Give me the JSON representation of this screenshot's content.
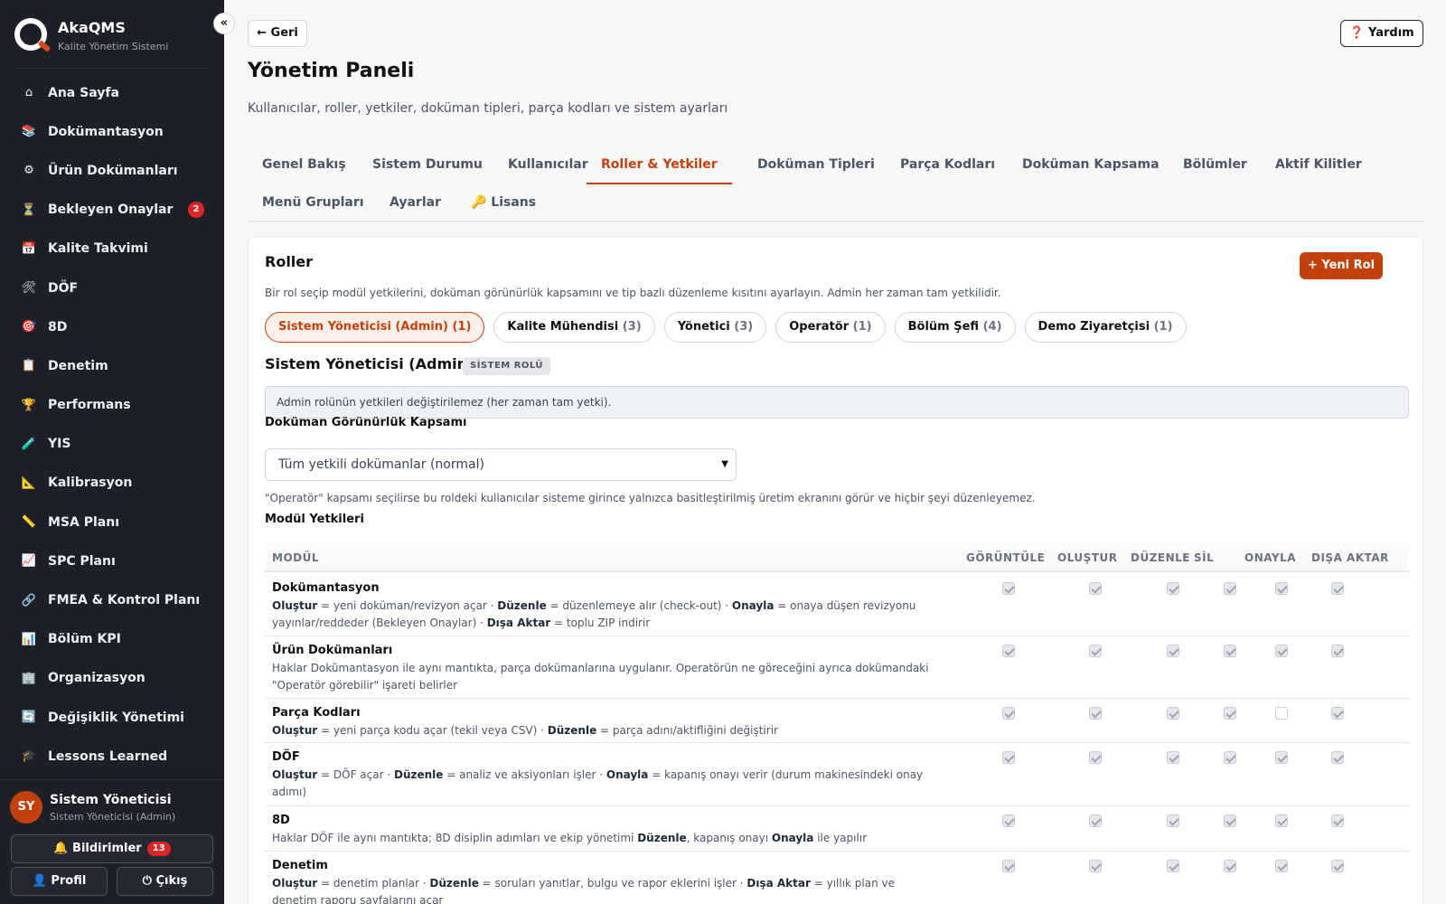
{
  "app": {
    "name": "AkaQMS",
    "subtitle": "Kalite Yönetim Sistemi",
    "collapse_icon": "«"
  },
  "sidebar": {
    "items": [
      {
        "label": "Ana Sayfa",
        "icon": "home-icon",
        "glyph": "⌂"
      },
      {
        "label": "Dokümantasyon",
        "icon": "books-icon",
        "glyph": "📚"
      },
      {
        "label": "Ürün Dokümanları",
        "icon": "gear-icon",
        "glyph": "⚙"
      },
      {
        "label": "Bekleyen Onaylar",
        "icon": "hourglass-icon",
        "glyph": "⏳",
        "badge": "2"
      },
      {
        "label": "Kalite Takvimi",
        "icon": "calendar-icon",
        "glyph": "📅"
      },
      {
        "label": "DÖF",
        "icon": "tools-icon",
        "glyph": "🛠"
      },
      {
        "label": "8D",
        "icon": "target-icon",
        "glyph": "🎯"
      },
      {
        "label": "Denetim",
        "icon": "clipboard-icon",
        "glyph": "📋"
      },
      {
        "label": "Performans",
        "icon": "trophy-icon",
        "glyph": "🏆"
      },
      {
        "label": "YIS",
        "icon": "test-tube-icon",
        "glyph": "🧪"
      },
      {
        "label": "Kalibrasyon",
        "icon": "triangle-ruler-icon",
        "glyph": "📐"
      },
      {
        "label": "MSA Planı",
        "icon": "ruler-icon",
        "glyph": "📏"
      },
      {
        "label": "SPC Planı",
        "icon": "chart-up-icon",
        "glyph": "📈"
      },
      {
        "label": "FMEA & Kontrol Planı",
        "icon": "link-icon",
        "glyph": "🔗"
      },
      {
        "label": "Bölüm KPI",
        "icon": "bar-chart-icon",
        "glyph": "📊"
      },
      {
        "label": "Organizasyon",
        "icon": "building-icon",
        "glyph": "🏢"
      },
      {
        "label": "Değişiklik Yönetimi",
        "icon": "refresh-icon",
        "glyph": "🔄"
      },
      {
        "label": "Lessons Learned",
        "icon": "graduation-cap-icon",
        "glyph": "🎓"
      }
    ]
  },
  "user": {
    "initials": "SY",
    "name": "Sistem Yöneticisi",
    "role": "Sistem Yöneticisi (Admin)",
    "notifications_label": "🔔 Bildirimler",
    "notifications_count": "13",
    "profile_label": "👤 Profil",
    "logout_label": "⏻ Çıkış"
  },
  "header": {
    "back_label": "← Geri",
    "help_label": "❓ Yardım",
    "title": "Yönetim Paneli",
    "subtitle": "Kullanıcılar, roller, yetkiler, doküman tipleri, parça kodları ve sistem ayarları"
  },
  "tabs": [
    {
      "label": "Genel Bakış"
    },
    {
      "label": "Sistem Durumu"
    },
    {
      "label": "Kullanıcılar"
    },
    {
      "label": "Roller & Yetkiler",
      "active": true
    },
    {
      "label": "Doküman Tipleri"
    },
    {
      "label": "Parça Kodları"
    },
    {
      "label": "Doküman Kapsama"
    },
    {
      "label": "Bölümler"
    },
    {
      "label": "Aktif Kilitler"
    },
    {
      "label": "Menü Grupları"
    },
    {
      "label": "Ayarlar"
    },
    {
      "label": "🔑 Lisans"
    }
  ],
  "roles": {
    "title": "Roller",
    "new_role_label": "+ Yeni Rol",
    "description": "Bir rol seçip modül yetkilerini, doküman görünürlük kapsamını ve tip bazlı düzenleme kısıtını ayarlayın. Admin her zaman tam yetkilidir.",
    "list": [
      {
        "name": "Sistem Yöneticisi (Admin)",
        "count": "(1)",
        "active": true
      },
      {
        "name": "Kalite Mühendisi",
        "count": "(3)"
      },
      {
        "name": "Yönetici",
        "count": "(3)"
      },
      {
        "name": "Operatör",
        "count": "(1)"
      },
      {
        "name": "Bölüm Şefi",
        "count": "(4)"
      },
      {
        "name": "Demo Ziyaretçisi",
        "count": "(1)"
      }
    ],
    "selected_title": "Sistem Yöneticisi (Admin)",
    "system_badge": "SİSTEM ROLÜ",
    "info": "Admin rolünün yetkileri değiştirilemez (her zaman tam yetki).",
    "scope_label": "Doküman Görünürlük Kapsamı",
    "scope_value": "Tüm yetkili dokümanlar (normal)",
    "scope_note": "\"Operatör\" kapsamı seçilirse bu roldeki kullanıcılar sisteme girince yalnızca basitleştirilmiş üretim ekranını görür ve hiçbir şeyi düzenleyemez.",
    "module_perms_label": "Modül Yetkileri"
  },
  "perm_table": {
    "columns": [
      "MODÜL",
      "GÖRÜNTÜLE",
      "OLUŞTUR",
      "DÜZENLE",
      "SİL",
      "ONAYLA",
      "DIŞA AKTAR"
    ],
    "rows": [
      {
        "name": "Dokümantasyon",
        "desc_html": "<b>Oluştur</b> = yeni doküman/revizyon açar · <b>Düzenle</b> = düzenlemeye alır (check-out) · <b>Onayla</b> = onaya düşen revizyonu yayınlar/reddeder (Bekleyen Onaylar) · <b>Dışa Aktar</b> = toplu ZIP indirir",
        "perms": [
          true,
          true,
          true,
          true,
          true,
          true
        ]
      },
      {
        "name": "Ürün Dokümanları",
        "desc_html": "Haklar Dokümantasyon ile aynı mantıkta, parça dokümanlarına uygulanır. Operatörün ne göreceğini ayrıca dokümandaki \"Operatör görebilir\" işareti belirler",
        "perms": [
          true,
          true,
          true,
          true,
          true,
          true
        ]
      },
      {
        "name": "Parça Kodları",
        "desc_html": "<b>Oluştur</b> = yeni parça kodu açar (tekil veya CSV) · <b>Düzenle</b> = parça adını/aktifliğini değiştirir",
        "perms": [
          true,
          true,
          true,
          true,
          false,
          true
        ]
      },
      {
        "name": "DÖF",
        "desc_html": "<b>Oluştur</b> = DÖF açar · <b>Düzenle</b> = analiz ve aksiyonları işler · <b>Onayla</b> = kapanış onayı verir (durum makinesindeki onay adımı)",
        "perms": [
          true,
          true,
          true,
          true,
          true,
          true
        ]
      },
      {
        "name": "8D",
        "desc_html": "Haklar DÖF ile aynı mantıkta; 8D disiplin adımları ve ekip yönetimi <b>Düzenle</b>, kapanış onayı <b>Onayla</b> ile yapılır",
        "perms": [
          true,
          true,
          true,
          true,
          true,
          true
        ]
      },
      {
        "name": "Denetim",
        "desc_html": "<b>Oluştur</b> = denetim planlar · <b>Düzenle</b> = soruları yanıtlar, bulgu ve rapor eklerini işler · <b>Dışa Aktar</b> = yıllık plan ve denetim raporu sayfalarını açar",
        "perms": [
          true,
          true,
          true,
          true,
          true,
          true
        ]
      }
    ]
  }
}
